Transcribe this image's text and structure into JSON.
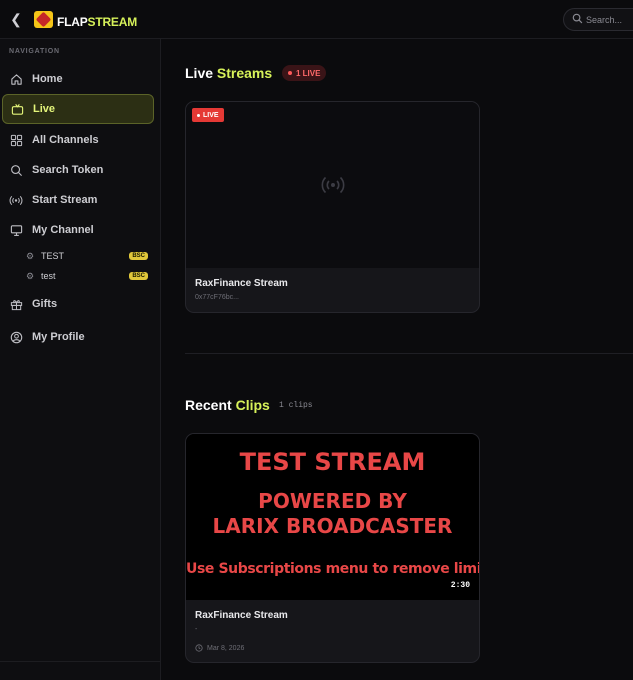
{
  "app": {
    "logo_part1": "FLAP",
    "logo_part2": "STREAM",
    "search_placeholder": "Search..."
  },
  "sidebar": {
    "heading": "NAVIGATION",
    "items": [
      {
        "label": "Home",
        "icon": "home-icon"
      },
      {
        "label": "Live",
        "icon": "tv-icon",
        "active": true
      },
      {
        "label": "All Channels",
        "icon": "grid-icon"
      },
      {
        "label": "Search Token",
        "icon": "search-icon"
      },
      {
        "label": "Start Stream",
        "icon": "broadcast-icon"
      },
      {
        "label": "My Channel",
        "icon": "monitor-icon"
      },
      {
        "label": "Gifts",
        "icon": "gift-icon"
      },
      {
        "label": "My Profile",
        "icon": "user-circle-icon"
      }
    ],
    "channels": [
      {
        "name": "TEST",
        "badge": "BSC"
      },
      {
        "name": "test",
        "badge": "BSC"
      }
    ]
  },
  "live": {
    "title_part1": "Live",
    "title_part2": "Streams",
    "count_label": "1 LIVE",
    "card": {
      "tag": "LIVE",
      "title": "RaxFinance Stream",
      "address": "0x77cF76bc..."
    }
  },
  "clips": {
    "title_part1": "Recent",
    "title_part2": "Clips",
    "count_label": "1 clips",
    "card": {
      "thumb_lines": [
        "TEST STREAM",
        "POWERED BY",
        "LARIX BROADCASTER",
        "Use Subscriptions menu to remove limits"
      ],
      "duration": "2:30",
      "title": "RaxFinance Stream",
      "subtitle": "-",
      "date": "Mar 8, 2026"
    }
  },
  "colors": {
    "accent": "#d7f25a",
    "live_red": "#e53935",
    "badge_yellow": "#e0c73a",
    "background": "#0b0b0d"
  }
}
